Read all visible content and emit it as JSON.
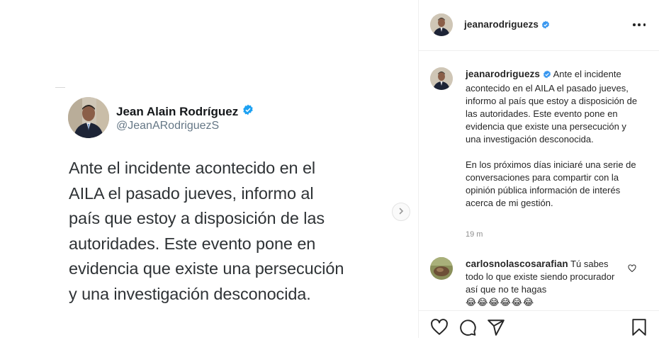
{
  "post": {
    "tweet": {
      "name": "Jean Alain Rodríguez",
      "handle": "@JeanARodriguezS",
      "text": "Ante el incidente acontecido en el AILA el pasado jueves, informo al país que estoy a disposición de las autoridades. Este evento pone en evidencia que existe una persecución y una investigación desconocida."
    }
  },
  "side": {
    "header": {
      "username": "jeanarodriguezs"
    },
    "caption": {
      "username": "jeanarodriguezs",
      "paragraph1": "Ante el incidente acontecido en el AILA el pasado jueves, informo al país que estoy a disposición de las autoridades. Este evento pone en evidencia que existe una persecución y una investigación desconocida.",
      "paragraph2": "En los próximos días iniciaré una serie de conversaciones para compartir con la opinión pública información de interés acerca de mi gestión.",
      "time": "19 m"
    },
    "comments": [
      {
        "username": "carlosnolascosarafian",
        "text": "Tú sabes todo lo que existe siendo procurador así que no te hagas",
        "emojis": "😂😂😂😂😂😂"
      }
    ]
  },
  "colors": {
    "verified_blue": "#3897f0",
    "twitter_verified": "#1da1f2",
    "text_primary": "#262626",
    "text_secondary": "#8e8e8e",
    "divider": "#efefef"
  },
  "icons": [
    "verified-badge-icon",
    "chevron-right-icon",
    "more-options-icon",
    "heart-icon",
    "comment-icon",
    "share-icon",
    "bookmark-icon"
  ]
}
